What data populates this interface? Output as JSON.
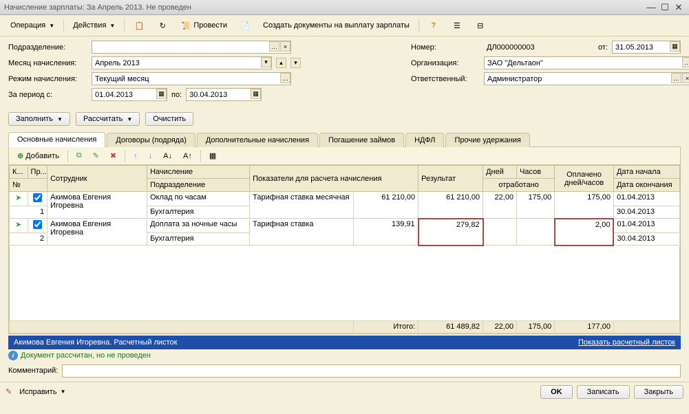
{
  "window": {
    "title": "Начисление зарплаты: За Апрель 2013. Не проведен"
  },
  "toolbar": {
    "operation": "Операция",
    "actions": "Действия",
    "post": "Провести",
    "create_docs": "Создать документы на выплату зарплаты"
  },
  "form": {
    "subdivision_label": "Подразделение:",
    "subdivision_value": "",
    "month_label": "Месяц начисления:",
    "month_value": "Апрель 2013",
    "mode_label": "Режим начисления:",
    "mode_value": "Текущий месяц",
    "period_label": "За период с:",
    "period_from": "01.04.2013",
    "period_to_label": "по:",
    "period_to": "30.04.2013",
    "number_label": "Номер:",
    "number_value": "ДЛ000000003",
    "date_label": "от:",
    "date_value": "31.05.2013",
    "org_label": "Организация:",
    "org_value": "ЗАО \"Дельтаон\"",
    "resp_label": "Ответственный:",
    "resp_value": "Администратор"
  },
  "actions": {
    "fill": "Заполнить",
    "calc": "Рассчитать",
    "clear": "Очистить"
  },
  "tabs": [
    {
      "label": "Основные начисления",
      "active": true
    },
    {
      "label": "Договоры (подряда)"
    },
    {
      "label": "Дополнительные начисления"
    },
    {
      "label": "Погашение займов"
    },
    {
      "label": "НДФЛ"
    },
    {
      "label": "Прочие удержания"
    }
  ],
  "grid_toolbar": {
    "add": "Добавить"
  },
  "grid": {
    "headers": {
      "k": "К...",
      "pr": "Пр...",
      "n": "№",
      "employee": "Сотрудник",
      "accrual": "Начисление",
      "subdivision": "Подразделение",
      "indicators": "Показатели для расчета начисления",
      "result": "Результат",
      "days": "Дней",
      "hours": "Часов",
      "worked": "отработано",
      "paid": "Оплачено дней/часов",
      "date_start": "Дата начала",
      "date_end": "Дата окончания"
    },
    "rows": [
      {
        "n": "1",
        "checked": true,
        "employee": "Акимова Евгения Игоревна",
        "accrual": "Оклад по часам",
        "subdivision": "Бухгалтерия",
        "indicator": "Тарифная ставка месячная",
        "indicator_val": "61 210,00",
        "result": "61 210,00",
        "days": "22,00",
        "hours": "175,00",
        "paid": "175,00",
        "date_start": "01.04.2013",
        "date_end": "30.04.2013",
        "hl_result": false,
        "hl_paid": false
      },
      {
        "n": "2",
        "checked": true,
        "employee": "Акимова Евгения Игоревна",
        "accrual": "Доплата за ночные часы",
        "subdivision": "Бухгалтерия",
        "indicator": "Тарифная ставка",
        "indicator_val": "139,91",
        "result": "279,82",
        "days": "",
        "hours": "",
        "paid": "2,00",
        "date_start": "01.04.2013",
        "date_end": "30.04.2013",
        "hl_result": true,
        "hl_paid": true
      }
    ],
    "totals": {
      "label": "Итого:",
      "result": "61 489,82",
      "days": "22,00",
      "hours": "175,00",
      "paid": "177,00"
    }
  },
  "bluebar": {
    "left": "Акимова Евгения Игоревна. Расчетный листок",
    "right": "Показать расчетный листок"
  },
  "status": "Документ рассчитан, но не проведен",
  "comment_label": "Комментарий:",
  "bottom": {
    "fix": "Исправить",
    "ok": "OK",
    "save": "Записать",
    "close": "Закрыть"
  }
}
